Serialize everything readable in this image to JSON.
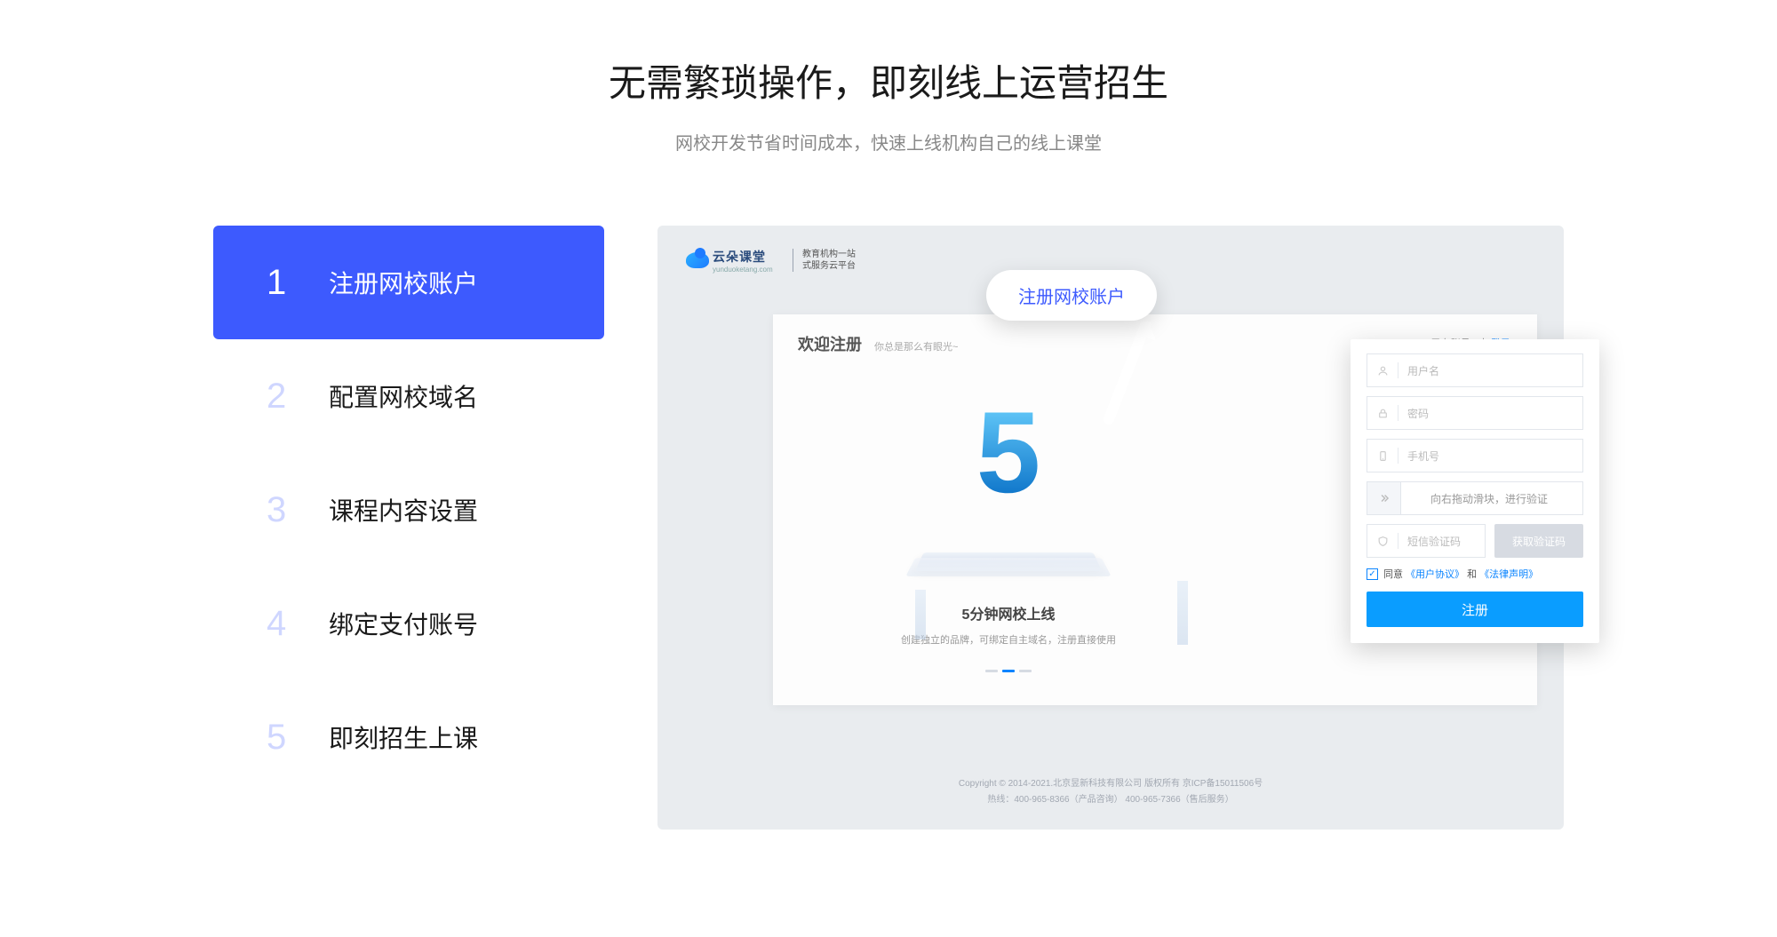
{
  "page": {
    "title": "无需繁琐操作，即刻线上运营招生",
    "subtitle": "网校开发节省时间成本，快速上线机构自己的线上课堂"
  },
  "steps": [
    {
      "num": "1",
      "label": "注册网校账户",
      "active": true
    },
    {
      "num": "2",
      "label": "配置网校域名",
      "active": false
    },
    {
      "num": "3",
      "label": "课程内容设置",
      "active": false
    },
    {
      "num": "4",
      "label": "绑定支付账号",
      "active": false
    },
    {
      "num": "5",
      "label": "即刻招生上课",
      "active": false
    }
  ],
  "callout": {
    "label": "注册网校账户"
  },
  "preview": {
    "logo_text": "云朵课堂",
    "logo_domain": "yunduoketang.com",
    "logo_tagline_1": "教育机构一站",
    "logo_tagline_2": "式服务云平台",
    "card_title": "欢迎注册",
    "card_sub": "你总是那么有眼光~",
    "login_prompt": "已有账号? 去 ",
    "login_link": "登录",
    "hero_big": "5",
    "hero_title": "5分钟网校上线",
    "hero_desc": "创建独立的品牌，可绑定自主域名，注册直接使用",
    "footer_line1": "Copyright © 2014-2021.北京昱新科技有限公司 版权所有   京ICP备15011506号",
    "footer_line2": "热线：400-965-8366（产品咨询）  400-965-7366（售后服务）"
  },
  "form": {
    "username_placeholder": "用户名",
    "password_placeholder": "密码",
    "phone_placeholder": "手机号",
    "slider_text": "向右拖动滑块，进行验证",
    "code_placeholder": "短信验证码",
    "code_button": "获取验证码",
    "agree_prefix": "同意",
    "agree_doc1": "《用户协议》",
    "agree_and": "和",
    "agree_doc2": "《法律声明》",
    "submit": "注册"
  }
}
